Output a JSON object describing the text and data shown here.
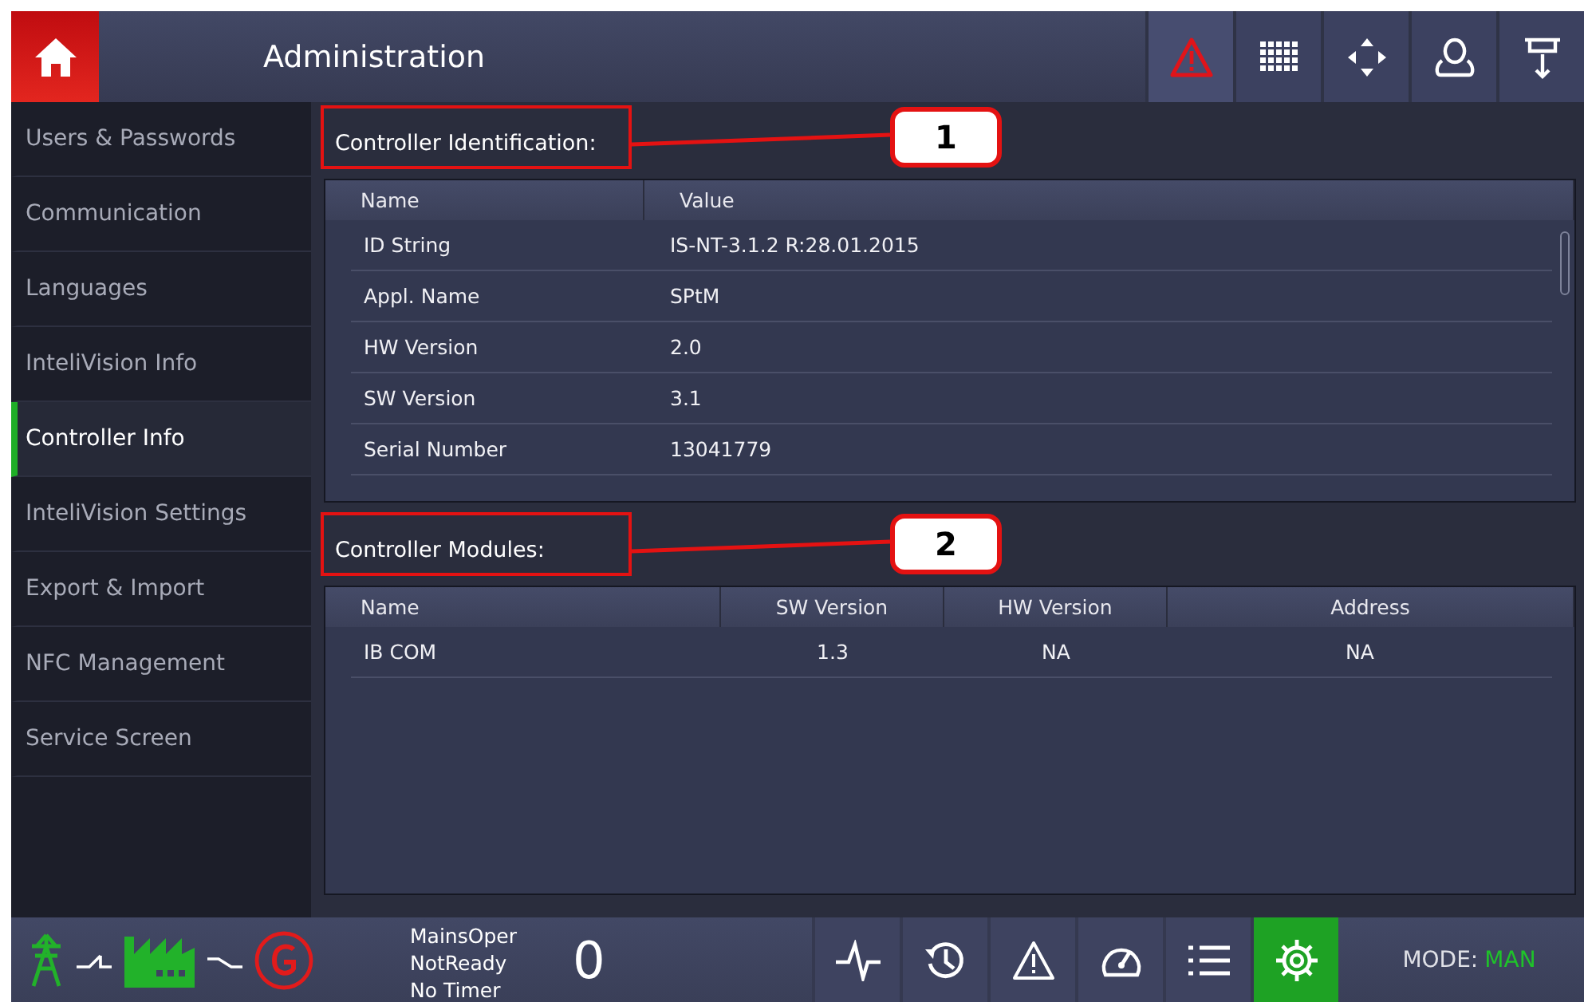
{
  "header": {
    "title": "Administration",
    "tools": [
      {
        "kind": "alarm",
        "active": true
      },
      {
        "kind": "keypad",
        "active": false
      },
      {
        "kind": "move",
        "active": false
      },
      {
        "kind": "user",
        "active": false
      },
      {
        "kind": "download",
        "active": false
      }
    ]
  },
  "sidebar": {
    "items": [
      {
        "label": "Users & Passwords",
        "selected": false
      },
      {
        "label": "Communication",
        "selected": false
      },
      {
        "label": "Languages",
        "selected": false
      },
      {
        "label": "InteliVision Info",
        "selected": false
      },
      {
        "label": "Controller Info",
        "selected": true
      },
      {
        "label": "InteliVision Settings",
        "selected": false
      },
      {
        "label": "Export & Import",
        "selected": false
      },
      {
        "label": "NFC Management",
        "selected": false
      },
      {
        "label": "Service Screen",
        "selected": false
      }
    ]
  },
  "sections": [
    {
      "title": "Controller Identification:",
      "callout": "1",
      "table": {
        "columns": [
          "Name",
          "Value"
        ],
        "rows": [
          [
            "ID String",
            "IS-NT-3.1.2 R:28.01.2015"
          ],
          [
            "Appl. Name",
            "SPtM"
          ],
          [
            "HW Version",
            "2.0"
          ],
          [
            "SW Version",
            "3.1"
          ],
          [
            "Serial Number",
            "13041779"
          ]
        ]
      }
    },
    {
      "title": "Controller Modules:",
      "callout": "2",
      "table": {
        "columns": [
          "Name",
          "SW Version",
          "HW Version",
          "Address"
        ],
        "rows": [
          [
            "IB COM",
            "1.3",
            "NA",
            "NA"
          ]
        ]
      }
    }
  ],
  "status_bar": {
    "status_lines": [
      "MainsOper",
      "NotReady",
      "No Timer"
    ],
    "counter": "0",
    "nav": [
      {
        "kind": "pulse",
        "selected": false
      },
      {
        "kind": "history",
        "selected": false
      },
      {
        "kind": "alarm",
        "selected": false
      },
      {
        "kind": "gauge",
        "selected": false
      },
      {
        "kind": "list",
        "selected": false
      },
      {
        "kind": "gear",
        "selected": true
      }
    ],
    "mode_label": "MODE:",
    "mode_value": "MAN"
  }
}
